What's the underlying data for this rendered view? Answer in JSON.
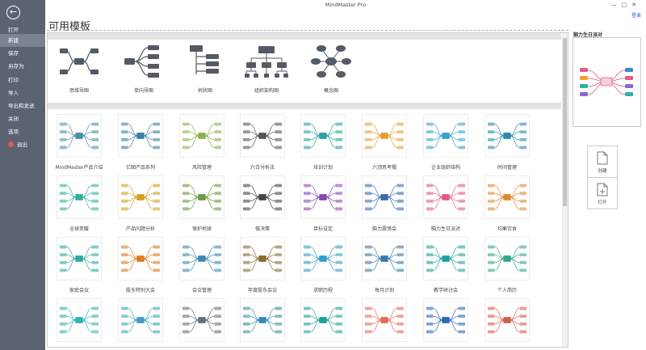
{
  "app": {
    "title": "MindMaster Pro",
    "login": "登录"
  },
  "sidebar": {
    "items": [
      {
        "label": "打开"
      },
      {
        "label": "新建",
        "active": true
      },
      {
        "label": "保存"
      },
      {
        "label": "另存为"
      },
      {
        "label": "打印"
      },
      {
        "label": "导入"
      },
      {
        "label": "导出和发送"
      },
      {
        "label": "关闭"
      },
      {
        "label": "选项"
      },
      {
        "label": "退出"
      }
    ]
  },
  "main": {
    "heading": "可用模板",
    "basic_templates": [
      {
        "label": "思维导图",
        "icon": "mindmap-icon"
      },
      {
        "label": "单向导图",
        "icon": "right-map-icon"
      },
      {
        "label": "树状图",
        "icon": "tree-map-icon"
      },
      {
        "label": "组织架构图",
        "icon": "org-chart-icon"
      },
      {
        "label": "概念图",
        "icon": "concept-map-icon"
      }
    ],
    "templates": [
      {
        "label": "MindMaster产品介绍",
        "accent": "#4a90a4"
      },
      {
        "label": "亿图产品系列",
        "accent": "#3a7ea8"
      },
      {
        "label": "风险管理",
        "accent": "#8ab34a"
      },
      {
        "label": "六合分析法",
        "accent": "#555555"
      },
      {
        "label": "培训计划",
        "accent": "#2aa0a0"
      },
      {
        "label": "六顶思考帽",
        "accent": "#e0a030"
      },
      {
        "label": "企业组织结构",
        "accent": "#3aa0c8"
      },
      {
        "label": "时间管理",
        "accent": "#2a8ab0"
      },
      {
        "label": "全球变暖",
        "accent": "#30b0a0"
      },
      {
        "label": "产品问题分析",
        "accent": "#d0a020"
      },
      {
        "label": "保护地球",
        "accent": "#6a9a40"
      },
      {
        "label": "做决策",
        "accent": "#444444"
      },
      {
        "label": "目标设定",
        "accent": "#8a4ab0"
      },
      {
        "label": "脑力震荡会",
        "accent": "#3a6ab0"
      },
      {
        "label": "脑力生日派对",
        "accent": "#e05a8a"
      },
      {
        "label": "均衡饮食",
        "accent": "#e08a30"
      },
      {
        "label": "家庭会议",
        "accent": "#30a8a0"
      },
      {
        "label": "股东特别大会",
        "accent": "#e07a20"
      },
      {
        "label": "会议管理",
        "accent": "#3a8ab0"
      },
      {
        "label": "年度股东会议",
        "accent": "#8a6a30"
      },
      {
        "label": "求职历程",
        "accent": "#30a0c8"
      },
      {
        "label": "每月计划",
        "accent": "#3a7aa8"
      },
      {
        "label": "教学研讨会",
        "accent": "#20a0a0"
      },
      {
        "label": "个人简历",
        "accent": "#30a890"
      },
      {
        "label": "",
        "accent": "#30b0b0"
      },
      {
        "label": "",
        "accent": "#40a0c0"
      },
      {
        "label": "",
        "accent": "#607080"
      },
      {
        "label": "",
        "accent": "#3a8ab0"
      },
      {
        "label": "",
        "accent": "#20a0a0"
      },
      {
        "label": "",
        "accent": "#e06a60"
      },
      {
        "label": "",
        "accent": "#2a6ab0"
      },
      {
        "label": "",
        "accent": "#d0604a"
      }
    ]
  },
  "right_panel": {
    "preview_title": "脑力生日派对",
    "create_label": "创建",
    "open_label": "打开"
  },
  "colors": {
    "sidebar_bg": "#5b6272",
    "sidebar_active": "#7c8393",
    "node": "#545a66",
    "exit": "#e05a4f",
    "link": "#2b6ad8"
  }
}
